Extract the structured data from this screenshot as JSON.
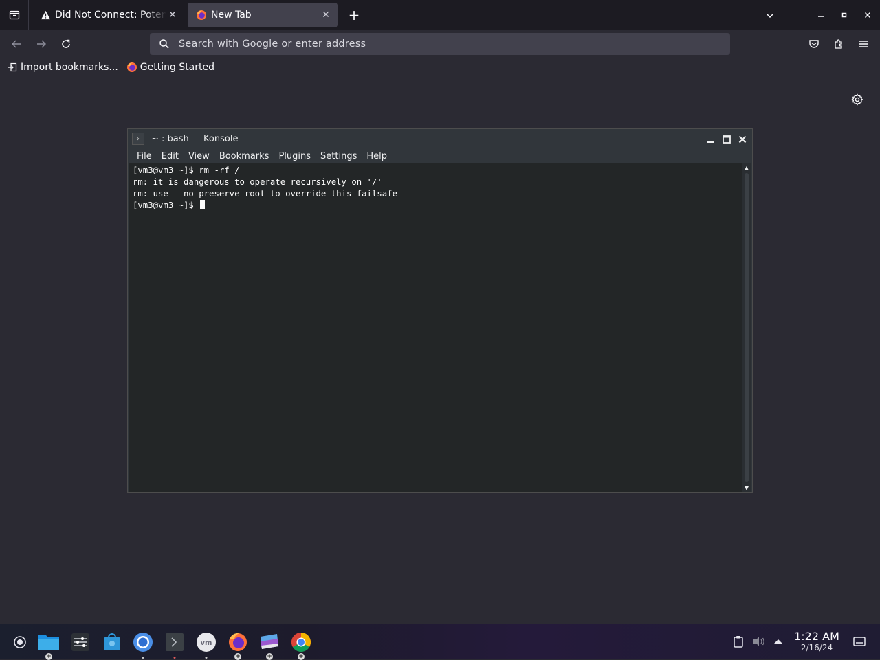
{
  "browser": {
    "tabs": [
      {
        "title": "Did Not Connect: Potential Security Issue",
        "icon": "warning-icon",
        "active": false
      },
      {
        "title": "New Tab",
        "icon": "firefox-icon",
        "active": true
      }
    ],
    "urlbar": {
      "placeholder": "Search with Google or enter address",
      "value": ""
    },
    "bookmarks": [
      {
        "label": "Import bookmarks...",
        "icon": "import-icon"
      },
      {
        "label": "Getting Started",
        "icon": "firefox-icon"
      }
    ]
  },
  "konsole": {
    "title": "~ : bash — Konsole",
    "menu": [
      "File",
      "Edit",
      "View",
      "Bookmarks",
      "Plugins",
      "Settings",
      "Help"
    ],
    "lines": [
      "[vm3@vm3 ~]$ rm -rf /",
      "rm: it is dangerous to operate recursively on '/'",
      "rm: use --no-preserve-root to override this failsafe",
      "[vm3@vm3 ~]$ "
    ]
  },
  "taskbar": {
    "apps": [
      "app-launcher",
      "file-manager",
      "system-settings",
      "software-store",
      "chromium",
      "konsole",
      "vmware",
      "firefox",
      "kde-discover",
      "chrome"
    ],
    "clock": {
      "time": "1:22 AM",
      "date": "2/16/24"
    }
  },
  "colors": {
    "chrome_bg": "#1c1b22",
    "toolbar_bg": "#2b2a33",
    "urlbar_bg": "#42414d",
    "terminal_bg": "#232627",
    "konsole_frame": "#31363b"
  }
}
